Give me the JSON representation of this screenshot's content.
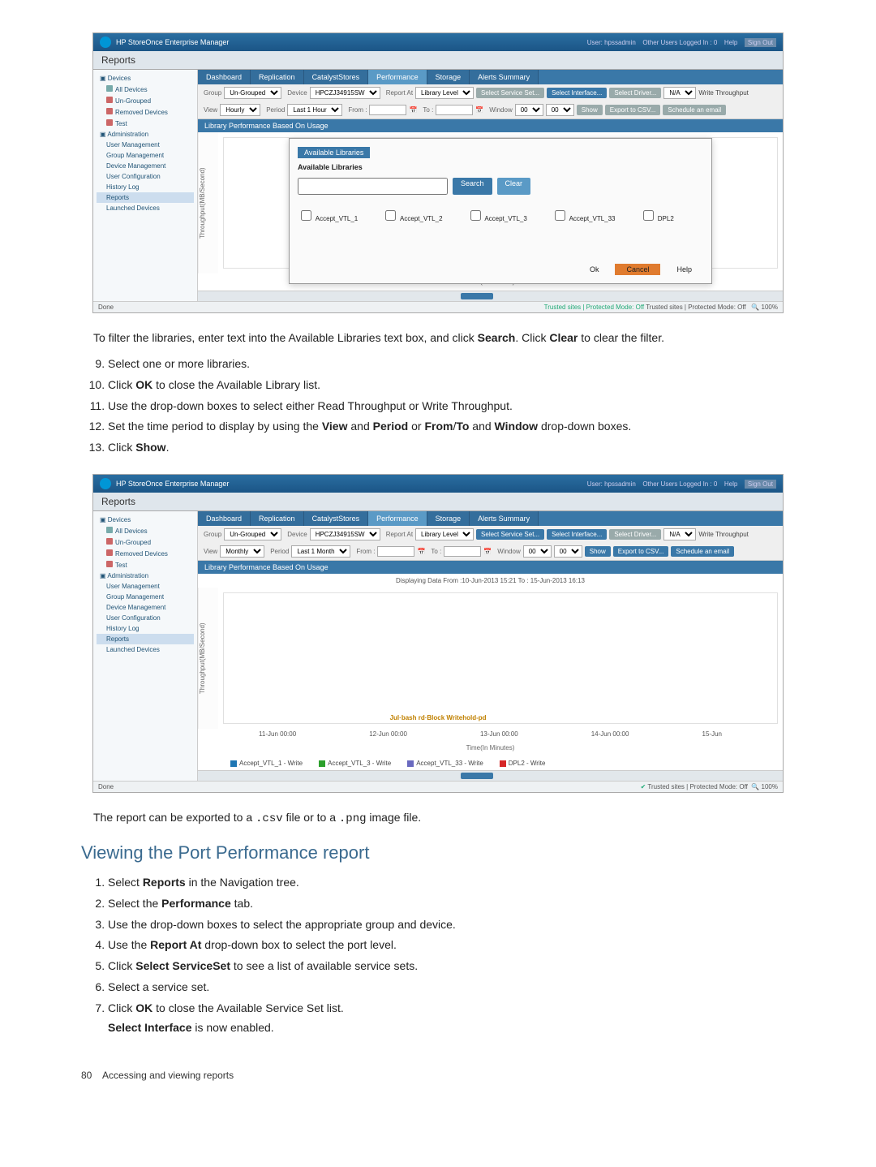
{
  "app_title": "HP StoreOnce Enterprise Manager",
  "topbar_right": {
    "user": "User: hpssadmin",
    "others": "Other Users Logged In : 0",
    "help": "Help",
    "signout": "Sign Out"
  },
  "reports_label": "Reports",
  "nav": {
    "devices": "Devices",
    "all_devices": "All Devices",
    "ungrouped": "Un-Grouped",
    "removed": "Removed Devices",
    "test": "Test",
    "admin": "Administration",
    "user_mgmt": "User Management",
    "group_mgmt": "Group Management",
    "device_mgmt": "Device Management",
    "user_config": "User Configuration",
    "history": "History Log",
    "reports": "Reports",
    "launched": "Launched Devices"
  },
  "tabs": [
    "Dashboard",
    "Replication",
    "CatalystStores",
    "Performance",
    "Storage",
    "Alerts Summary"
  ],
  "filters": {
    "group": "Group",
    "group_val": "Un-Grouped",
    "device": "Device",
    "device_val": "HPCZJ34915SW",
    "report_at": "Report At",
    "report_at_val": "Library Level",
    "select_service": "Select Service Set...",
    "select_interface": "Select Interface...",
    "select_driver": "Select Driver...",
    "na": "N/A",
    "write_throughput": "Write Throughput",
    "view": "View",
    "view_hourly": "Hourly",
    "view_monthly": "Monthly",
    "period": "Period",
    "period_1h": "Last 1 Hour",
    "period_1m": "Last 1 Month",
    "from": "From :",
    "to": "To :",
    "window": "Window",
    "w1": "00",
    "w2": "00",
    "show": "Show",
    "export": "Export to CSV...",
    "schedule": "Schedule an email"
  },
  "perf_title": "Library Performance Based On Usage",
  "modal": {
    "tab": "Available Libraries",
    "title": "Available Libraries",
    "search": "Search",
    "clear": "Clear",
    "items": [
      "Accept_VTL_1",
      "Accept_VTL_2",
      "Accept_VTL_3",
      "Accept_VTL_33",
      "DPL2"
    ],
    "ok": "Ok",
    "cancel": "Cancel",
    "help": "Help"
  },
  "yaxis": "Throughput(MB/Second)",
  "xaxis": "Time(In Minutes)",
  "status": {
    "done": "Done",
    "trusted": "Trusted sites | Protected Mode: Off",
    "zoom": "100%"
  },
  "body": {
    "intro": "To filter the libraries, enter text into the Available Libraries text box, and click ",
    "search_bold": "Search",
    "intro2": ". Click ",
    "clear_bold": "Clear",
    "intro3": " to clear the filter.",
    "step9": "Select one or more libraries.",
    "step10a": "Click ",
    "step10b": "OK",
    "step10c": " to close the Available Library list.",
    "step11": "Use the drop-down boxes to select either Read Throughput or Write Throughput.",
    "step12a": "Set the time period to display by using the ",
    "view": "View",
    "and1": " and ",
    "period": "Period",
    "or": " or ",
    "from": "From",
    "slash": "/",
    "to_b": "To",
    "and2": " and ",
    "window": "Window",
    "step12b": " drop-down boxes.",
    "step13a": "Click ",
    "step13b": "Show",
    "step13c": "."
  },
  "second": {
    "data_range": "Displaying Data From :10-Jun-2013 15:21 To : 15-Jun-2013 16:13",
    "dots": "Jul·bash rd·Block Writehold-pd",
    "xticks": [
      "11-Jun 00:00",
      "12-Jun 00:00",
      "13-Jun 00:00",
      "14-Jun 00:00",
      "15-Jun"
    ],
    "legend": [
      "Accept_VTL_1 - Write",
      "Accept_VTL_3 - Write",
      "Accept_VTL_33 - Write",
      "DPL2 - Write"
    ]
  },
  "export_line": {
    "a": "The report can be exported to a ",
    "b": ".csv",
    "c": " file or to a ",
    "d": ".png",
    "e": " image file."
  },
  "heading": "Viewing the Port Performance report",
  "steps2": {
    "s1a": "Select ",
    "s1b": "Reports",
    "s1c": " in the Navigation tree.",
    "s2a": "Select the ",
    "s2b": "Performance",
    "s2c": " tab.",
    "s3": "Use the drop-down boxes to select the appropriate group and device.",
    "s4a": "Use the ",
    "s4b": "Report At",
    "s4c": " drop-down box to select the port level.",
    "s5a": "Click ",
    "s5b": "Select ServiceSet",
    "s5c": " to see a list of available service sets.",
    "s6": "Select a service set.",
    "s7a": "Click ",
    "s7b": "OK",
    "s7c": " to close the Available Service Set list.",
    "s7d": "Select Interface",
    "s7e": " is now enabled."
  },
  "footer": {
    "page": "80",
    "txt": "Accessing and viewing reports"
  },
  "chart_data": {
    "type": "line",
    "title": "Library Performance Based On Usage",
    "ylabel": "Throughput(MB/Second)",
    "xlabel": "Time(In Minutes)",
    "x": [
      "11-Jun 00:00",
      "12-Jun 00:00",
      "13-Jun 00:00",
      "14-Jun 00:00",
      "15-Jun 00:00"
    ],
    "series": [
      {
        "name": "Accept_VTL_1 - Write",
        "values": [
          0,
          0,
          0,
          0,
          0
        ]
      },
      {
        "name": "Accept_VTL_3 - Write",
        "values": [
          0,
          0,
          0,
          0,
          0
        ]
      },
      {
        "name": "Accept_VTL_33 - Write",
        "values": [
          0,
          0,
          0,
          0,
          0
        ]
      },
      {
        "name": "DPL2 - Write",
        "values": [
          0,
          0,
          0,
          0,
          0
        ]
      }
    ],
    "ylim": [
      0,
      10
    ]
  }
}
